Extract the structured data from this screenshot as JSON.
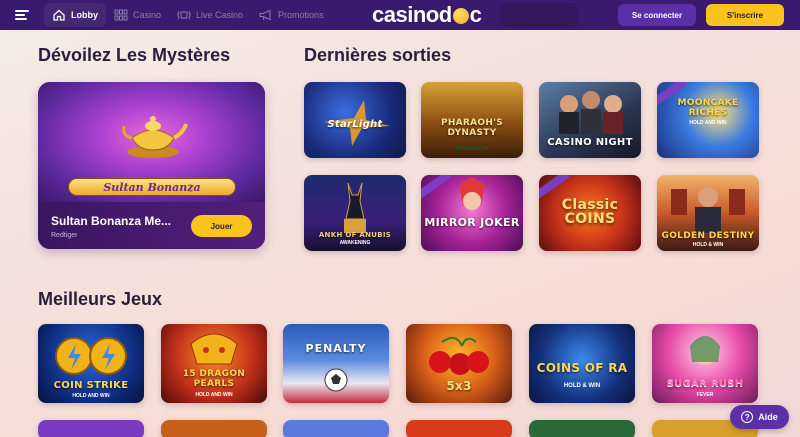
{
  "header": {
    "logo_text_left": "casino",
    "logo_text_right": "c",
    "nav": [
      {
        "label": "Lobby",
        "icon": "home-icon",
        "active": true
      },
      {
        "label": "Casino",
        "icon": "grid-icon",
        "active": false
      },
      {
        "label": "Live Casino",
        "icon": "live-icon",
        "active": false
      },
      {
        "label": "Promotions",
        "icon": "megaphone-icon",
        "active": false
      }
    ],
    "login_label": "Se connecter",
    "signup_label": "S'inscrire"
  },
  "sections": {
    "mysteries_title": "Dévoilez Les Mystères",
    "latest_title": "Dernières sorties",
    "best_title": "Meilleurs Jeux"
  },
  "featured": {
    "banner": "Sultan Bonanza",
    "title": "Sultan Bonanza Me...",
    "provider": "Redtiger",
    "play_label": "Jouer"
  },
  "latest_games": [
    {
      "label": "StarLight",
      "sub": ""
    },
    {
      "label": "PHARAOH'S DYNASTY",
      "sub": "PRIZEMATCH"
    },
    {
      "label": "CASINO NIGHT",
      "sub": ""
    },
    {
      "label": "MOONCAKE RICHES",
      "sub": "HOLD AND WIN"
    },
    {
      "label": "ANKH OF ANUBIS",
      "sub": "AWAKENING"
    },
    {
      "label": "MIRROR JOKER",
      "sub": ""
    },
    {
      "label": "Classic COINS",
      "sub": ""
    },
    {
      "label": "GOLDEN DESTINY",
      "sub": "HOLD & WIN"
    }
  ],
  "best_games": [
    {
      "label": "COIN STRIKE",
      "sub": "HOLD AND WIN"
    },
    {
      "label": "15 DRAGON PEARLS",
      "sub": "HOLD AND WIN"
    },
    {
      "label": "PENALTY",
      "sub": ""
    },
    {
      "label": "5x3",
      "sub": ""
    },
    {
      "label": "COINS OF RA",
      "sub": "HOLD & WIN"
    },
    {
      "label": "SUGAR RUSH",
      "sub": "FEVER"
    }
  ],
  "help_label": "Aide"
}
